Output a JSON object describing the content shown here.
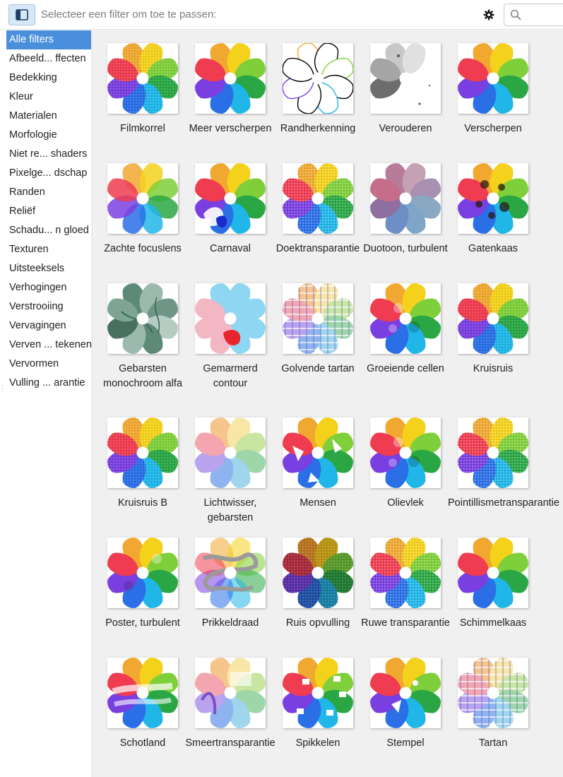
{
  "toolbar": {
    "prompt": "Selecteer een filter om toe te passen:",
    "search_value": "",
    "icons": {
      "toggle": "sidebar-toggle-icon",
      "settings": "gear-icon",
      "search": "search-icon"
    }
  },
  "sidebar": {
    "categories": [
      "Alle filters",
      "Afbeeld... ffecten",
      "Bedekking",
      "Kleur",
      "Materialen",
      "Morfologie",
      "Niet re... shaders",
      "Pixelge... dschap",
      "Randen",
      "Reliëf",
      "Schadu... n gloed",
      "Texturen",
      "Uitsteeksels",
      "Verhogingen",
      "Verstrooiing",
      "Vervagingen",
      "Verven ... tekenen",
      "Vervormen",
      "Vulling ... arantie"
    ],
    "selected": "Alle filters"
  },
  "filters": [
    {
      "label": "Filmkorrel",
      "style": "grain"
    },
    {
      "label": "Meer verscherpen",
      "style": "normal"
    },
    {
      "label": "Randherkenning",
      "style": "edges"
    },
    {
      "label": "Verouderen",
      "style": "aged"
    },
    {
      "label": "Verscherpen",
      "style": "normal"
    },
    {
      "label": "Zachte focuslens",
      "style": "soft"
    },
    {
      "label": "Carnaval",
      "style": "carnival"
    },
    {
      "label": "Doektransparantie",
      "style": "speckle"
    },
    {
      "label": "Duotoon, turbulent",
      "style": "duotone"
    },
    {
      "label": "Gatenkaas",
      "style": "holes"
    },
    {
      "label": "Gebarsten monochroom alfa",
      "style": "mono"
    },
    {
      "label": "Gemarmerd contour",
      "style": "marble"
    },
    {
      "label": "Golvende tartan",
      "style": "tartan"
    },
    {
      "label": "Groeiende cellen",
      "style": "cells"
    },
    {
      "label": "Kruisruis",
      "style": "grain"
    },
    {
      "label": "Kruisruis B",
      "style": "grain"
    },
    {
      "label": "Lichtwisser, gebarsten",
      "style": "pale"
    },
    {
      "label": "Mensen",
      "style": "people"
    },
    {
      "label": "Olievlek",
      "style": "cells"
    },
    {
      "label": "Pointillismetransparantie",
      "style": "speckle"
    },
    {
      "label": "Poster, turbulent",
      "style": "poster"
    },
    {
      "label": "Prikkeldraad",
      "style": "wire"
    },
    {
      "label": "Ruis opvulling",
      "style": "dark"
    },
    {
      "label": "Ruwe transparantie",
      "style": "rough"
    },
    {
      "label": "Schimmelkaas",
      "style": "normal"
    },
    {
      "label": "Schotland",
      "style": "brush"
    },
    {
      "label": "Smeertransparantie",
      "style": "smear"
    },
    {
      "label": "Spikkelen",
      "style": "spots"
    },
    {
      "label": "Stempel",
      "style": "stamp"
    },
    {
      "label": "Tartan",
      "style": "tartan"
    }
  ],
  "petal_colors": [
    "#f0a830",
    "#f4d21c",
    "#7fcf3a",
    "#2aa744",
    "#20b6e8",
    "#2a6fe6",
    "#7a3fe0",
    "#ef3c50"
  ],
  "accent_color": "#4a8fdc"
}
